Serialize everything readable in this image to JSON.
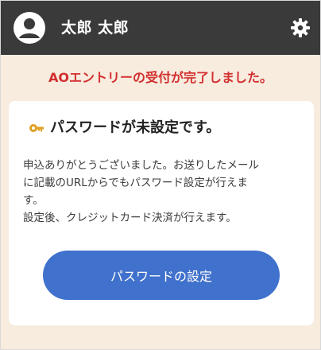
{
  "header": {
    "user_name": "太郎 太郎",
    "avatar_icon": "user-avatar-icon",
    "settings_icon": "gear-icon",
    "background_color": "#3a3a3a"
  },
  "banner": {
    "message": "AOエントリーの受付が完了しました。",
    "color": "#d22f2f"
  },
  "card": {
    "title_icon": "key-icon",
    "title": "パスワードが未設定です。",
    "body_lines": [
      "申込ありがとうございました。お送りしたメール",
      "に記載のURLからでもパスワード設定が行えま",
      "す。",
      "設定後、クレジットカード決済が行えます。"
    ],
    "button_label": "パスワードの設定",
    "button_color": "#4071cc"
  },
  "page_background": "#f8ecdf"
}
